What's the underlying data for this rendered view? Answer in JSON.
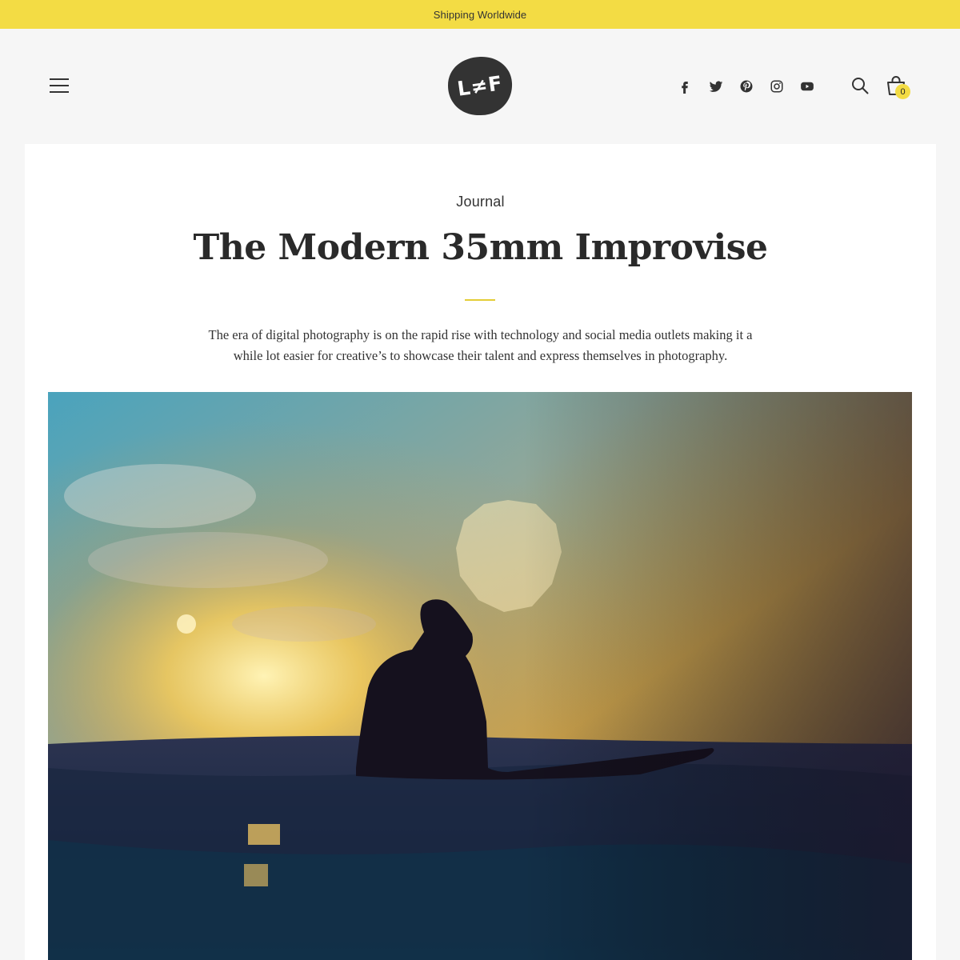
{
  "announcement": {
    "text": "Shipping Worldwide"
  },
  "header": {
    "logo_text": "L≠F",
    "social": [
      {
        "name": "facebook-icon"
      },
      {
        "name": "twitter-icon"
      },
      {
        "name": "pinterest-icon"
      },
      {
        "name": "instagram-icon"
      },
      {
        "name": "youtube-icon"
      }
    ],
    "cart_count": "0"
  },
  "article": {
    "category": "Journal",
    "title": "The Modern 35mm Improvise",
    "excerpt": "The era of digital photography is on the rapid rise with technology and social media outlets making it a while lot easier for creative’s to showcase their talent and express themselves in photography."
  },
  "colors": {
    "accent": "#f3dc44",
    "background": "#f6f6f6",
    "card": "#ffffff",
    "text": "#2a2a2a"
  }
}
